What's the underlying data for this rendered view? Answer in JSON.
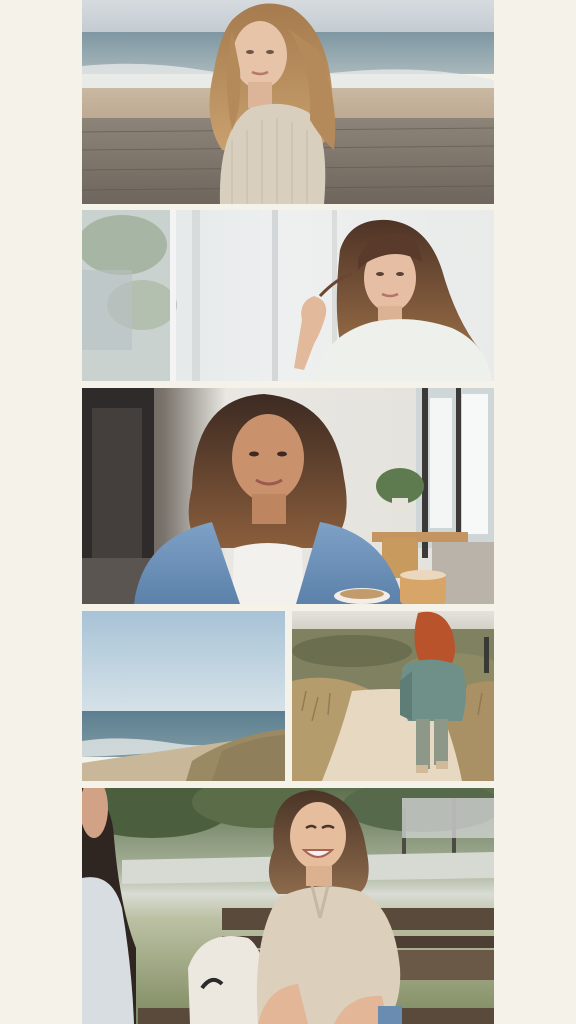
{
  "collage": {
    "background_color": "#f5f2e9",
    "photos": [
      {
        "subject": "woman-on-boardwalk-by-sea"
      },
      {
        "subject": "woman-with-bangs-by-window"
      },
      {
        "subject": "woman-in-denim-jacket-in-cafe"
      },
      {
        "subject": "sea-and-beach-landscape"
      },
      {
        "subject": "red-haired-woman-walking-on-sand-path"
      },
      {
        "subject": "laughing-woman-on-park-bench"
      }
    ]
  }
}
